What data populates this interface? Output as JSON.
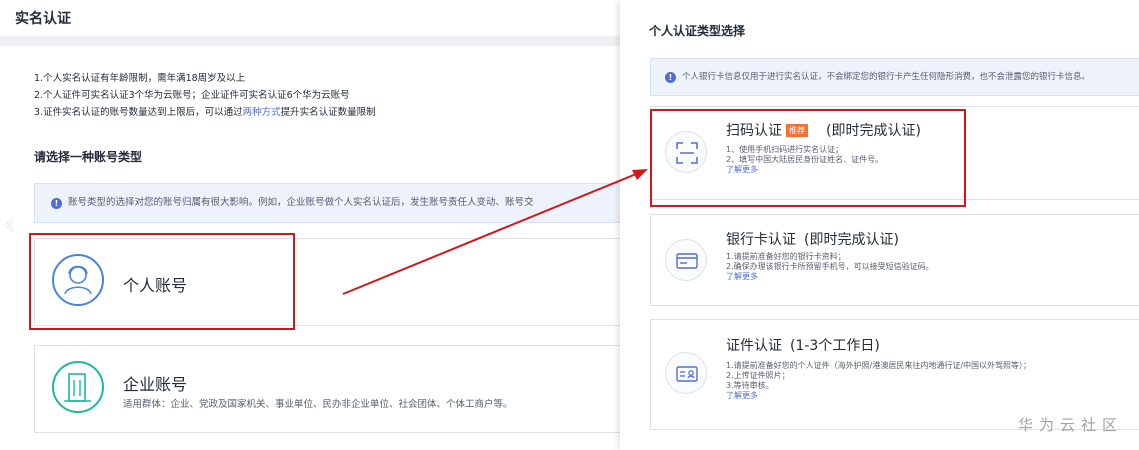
{
  "left": {
    "title": "实名认证",
    "rules": [
      "1.个人实名认证有年龄限制，需年满18周岁及以上",
      "2.个人证件可实名认证3个华为云账号；企业证件可实名认证6个华为云账号"
    ],
    "rule3_prefix": "3.证件实名认证的账号数量达到上限后，可以通过",
    "rule3_link": "两种方式",
    "rule3_suffix": "提升实名认证数量限制",
    "choose_title": "请选择一种账号类型",
    "tip": "账号类型的选择对您的账号归属有很大影响。例如，企业账号做个人实名认证后，发生账号责任人变动、账号交",
    "personal": {
      "name": "个人账号",
      "icon": "person-icon"
    },
    "enterprise": {
      "name": "企业账号",
      "desc": "适用群体：企业、党政及国家机关、事业单位、民办非企业单位、社会团体、个体工商户等。",
      "icon": "building-icon"
    }
  },
  "right": {
    "title": "个人认证类型选择",
    "tip": "个人银行卡信息仅用于进行实名认证，不会绑定您的银行卡产生任何隐形消费，也不会泄露您的银行卡信息。",
    "cards": [
      {
        "title": "扫码认证",
        "badge": "推荐",
        "time": "(即时完成认证)",
        "lines": [
          "1、使用手机扫码进行实名认证；",
          "2、填写中国大陆居民身份证姓名、证件号。"
        ],
        "link": "了解更多",
        "icon": "scan-icon"
      },
      {
        "title": "银行卡认证",
        "time": "(即时完成认证)",
        "lines": [
          "1.请提前准备好您的银行卡资料；",
          "2.确保办理该银行卡所预留手机号，可以接受短信验证码。"
        ],
        "link": "了解更多",
        "icon": "bank-card-icon"
      },
      {
        "title": "证件认证",
        "time": "(1-3个工作日)",
        "lines": [
          "1.请提前准备好您的个人证件（海外护照/港澳居民来往内地通行证/中国以外驾照等）；",
          "2.上传证件照片；",
          "3.等待审核。"
        ],
        "link": "了解更多",
        "icon": "id-card-icon"
      }
    ]
  },
  "watermark": "华为云社区",
  "colors": {
    "accent": "#526ecc",
    "annotation": "#d0181b",
    "badge": "#f66f35"
  }
}
